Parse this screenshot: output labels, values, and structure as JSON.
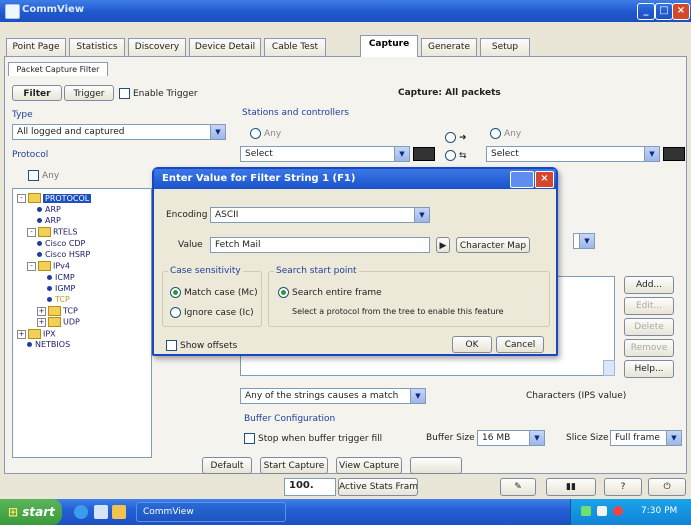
{
  "window": {
    "title": "CommView"
  },
  "tabs": [
    "Point Page",
    "Statistics",
    "Discovery",
    "Device Detail",
    "Cable Test",
    "Capture",
    "Generate",
    "Setup"
  ],
  "subtab": "Packet Capture Filter",
  "filter": {
    "filter_btn": "Filter",
    "trigger_btn": "Trigger",
    "enable_trigger": "Enable Trigger",
    "capture_label": "Capture: All packets",
    "type_label": "Type",
    "type_value": "All logged and captured",
    "protocol_label": "Protocol",
    "station_label": "Stations and controllers",
    "any_label": "Any",
    "select_label": "Select"
  },
  "tree": [
    {
      "label": "PROTOCOL",
      "depth": 0,
      "kind": "folder",
      "selected": true
    },
    {
      "label": "ARP",
      "depth": 1,
      "kind": "leaf"
    },
    {
      "label": "ARP",
      "depth": 1,
      "kind": "leaf"
    },
    {
      "label": "RTELS",
      "depth": 0,
      "kind": "folder"
    },
    {
      "label": "Cisco CDP",
      "depth": 1,
      "kind": "leaf"
    },
    {
      "label": "Cisco HSRP",
      "depth": 1,
      "kind": "leaf"
    },
    {
      "label": "IPv4",
      "depth": 0,
      "kind": "folder"
    },
    {
      "label": "ICMP",
      "depth": 2,
      "kind": "leaf"
    },
    {
      "label": "IGMP",
      "depth": 2,
      "kind": "leaf"
    },
    {
      "label": "TCP",
      "depth": 2,
      "kind": "leaf",
      "highlight": true
    },
    {
      "label": "TCP",
      "depth": 1,
      "kind": "folder"
    },
    {
      "label": "UDP",
      "depth": 1,
      "kind": "folder"
    },
    {
      "label": "IPX",
      "depth": 0,
      "kind": "folder"
    },
    {
      "label": "NETBIOS",
      "depth": 1,
      "kind": "leaf"
    }
  ],
  "dialog": {
    "title": "Enter Value for Filter String 1 (F1)",
    "encoding_label": "Encoding",
    "encoding_value": "ASCII",
    "value_label": "Value",
    "value_value": "Fetch Mail",
    "char_map_btn": "Character Map",
    "case_group": "Case sensitivity",
    "match_case": "Match case (Mc)",
    "ignore_case": "Ignore case (Ic)",
    "search_group": "Search start point",
    "search_offset": "Search entire frame",
    "search_hint": "Select a protocol from the tree to enable this feature",
    "show_offsets": "Show offsets",
    "ok": "OK",
    "cancel": "Cancel"
  },
  "right_buttons": [
    "Add...",
    "Edit...",
    "Delete",
    "Remove",
    "Help..."
  ],
  "lower": {
    "strings_dropdown": "Any of the strings causes a match",
    "characters_label": "Characters (IPS value)",
    "buffer_group": "Buffer Configuration",
    "stop_when_full": "Stop when buffer trigger fill",
    "buffer_size_label": "Buffer Size",
    "buffer_size_value": "16 MB",
    "slice_label": "Slice Size",
    "slice_value": "Full frame"
  },
  "bottom_buttons": [
    "Default",
    "Start Capture",
    "View Capture"
  ],
  "status": {
    "percent": "100.",
    "action": "Active Stats Frame"
  },
  "taskbar": {
    "start": "start",
    "task": "CommView",
    "time": "7:30 PM"
  },
  "colors": {
    "title_blue": "#1f58d0",
    "xp_green": "#3a9a3a",
    "face": "#ece9d8"
  }
}
